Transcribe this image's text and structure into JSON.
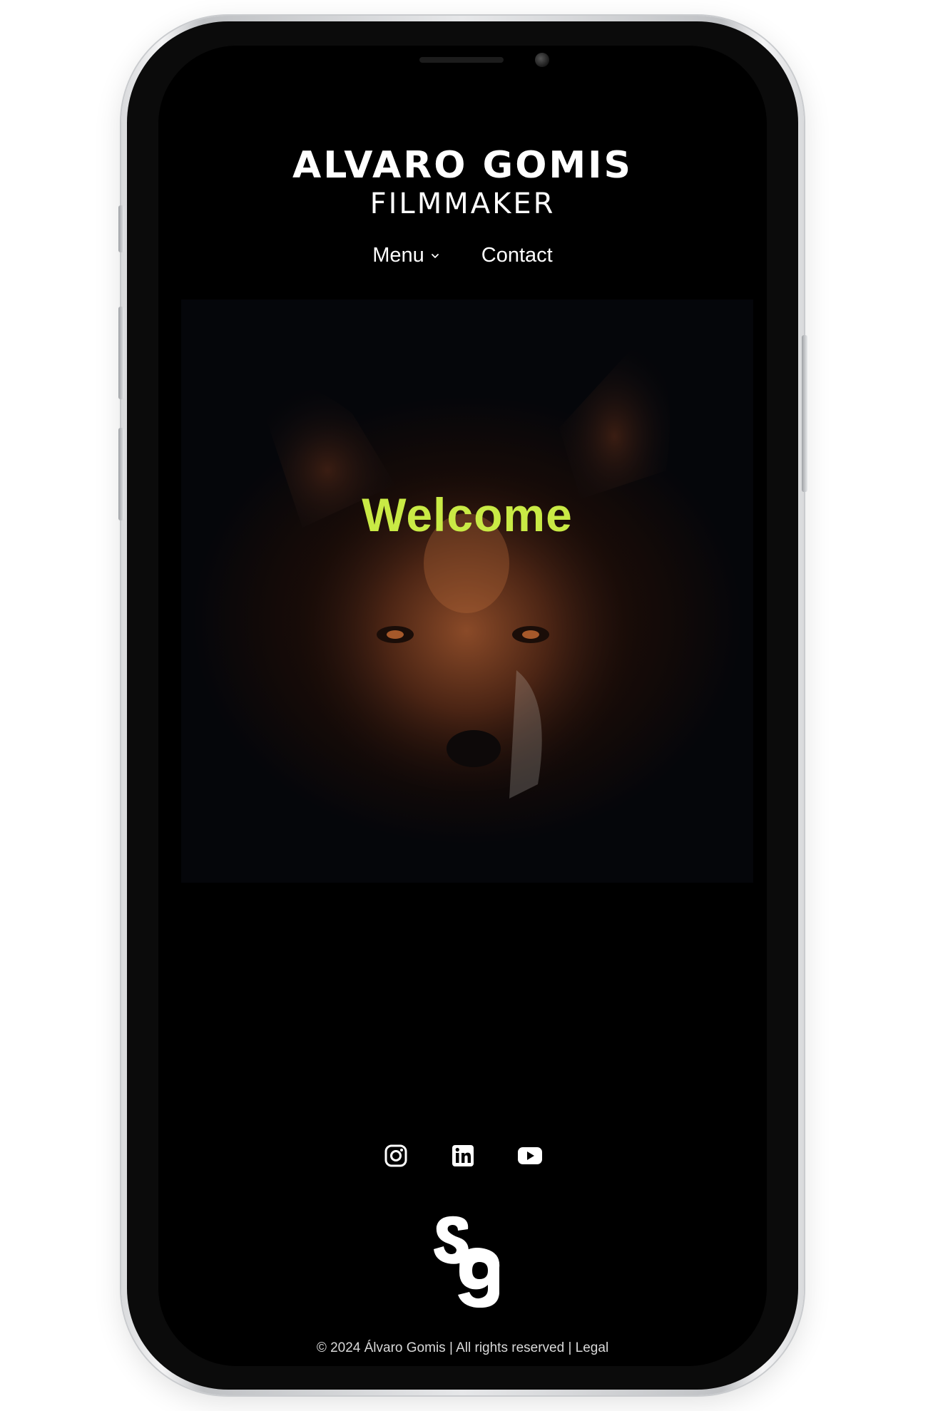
{
  "header": {
    "brand_name": "ALVARO GOMIS",
    "brand_role": "FILMMAKER"
  },
  "nav": {
    "menu_label": "Menu",
    "contact_label": "Contact"
  },
  "hero": {
    "title": "Welcome",
    "title_color": "#c9ea45"
  },
  "social": {
    "icons": [
      "instagram-icon",
      "linkedin-icon",
      "youtube-icon"
    ]
  },
  "footer": {
    "copyright": "© 2024 Álvaro Gomis | All rights reserved |",
    "legal_label": "Legal"
  }
}
